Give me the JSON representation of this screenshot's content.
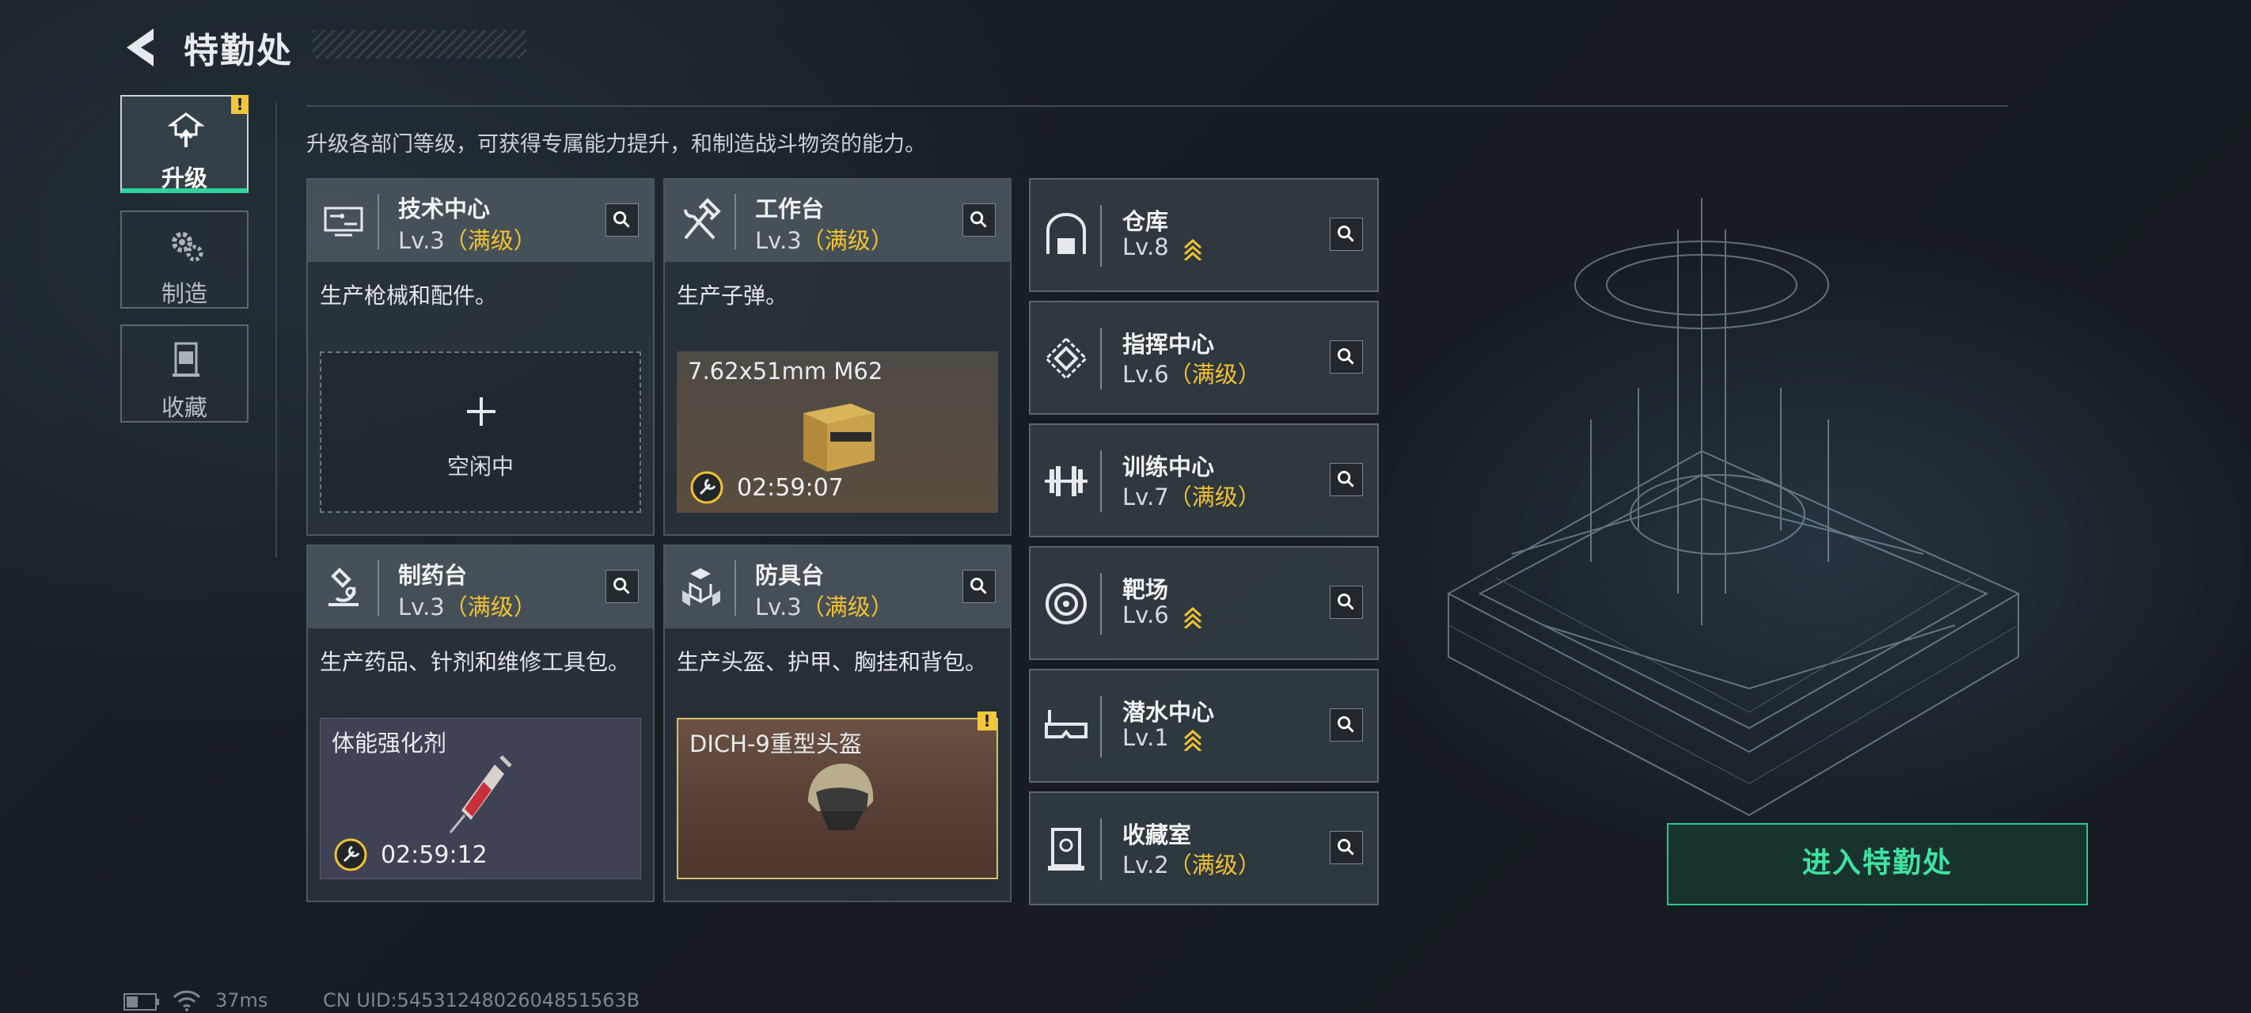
{
  "header": {
    "title": "特勤处",
    "back_icon": "back-arrow-icon"
  },
  "tabs": [
    {
      "label": "升级",
      "icon": "upgrade-icon",
      "active": true,
      "alert": "!"
    },
    {
      "label": "制造",
      "icon": "gear-icon",
      "active": false
    },
    {
      "label": "收藏",
      "icon": "trophy-icon",
      "active": false
    }
  ],
  "description": "升级各部门等级，可获得专属能力提升，和制造战斗物资的能力。",
  "facilities": [
    {
      "name": "技术中心",
      "level": "Lv.3",
      "max": "（满级）",
      "desc": "生产枪械和配件。",
      "icon": "tech-center-icon",
      "slot": {
        "state": "idle",
        "label": "空闲中"
      }
    },
    {
      "name": "工作台",
      "level": "Lv.3",
      "max": "（满级）",
      "desc": "生产子弹。",
      "icon": "hammer-wrench-icon",
      "slot": {
        "state": "producing",
        "item": "7.62x51mm M62",
        "time": "02:59:07",
        "item_icon": "ammo-box-icon"
      }
    },
    {
      "name": "制药台",
      "level": "Lv.3",
      "max": "（满级）",
      "desc": "生产药品、针剂和维修工具包。",
      "icon": "microscope-icon",
      "slot": {
        "state": "producing",
        "item": "体能强化剂",
        "time": "02:59:12",
        "item_icon": "syringe-icon"
      }
    },
    {
      "name": "防具台",
      "level": "Lv.3",
      "max": "（满级）",
      "desc": "生产头盔、护甲、胸挂和背包。",
      "icon": "armor-blocks-icon",
      "slot": {
        "state": "complete",
        "item": "DICH-9重型头盔",
        "alert": "!",
        "item_icon": "helmet-icon"
      }
    }
  ],
  "rooms": [
    {
      "name": "仓库",
      "level": "Lv.8",
      "max": "",
      "upgradable": true,
      "icon": "warehouse-icon"
    },
    {
      "name": "指挥中心",
      "level": "Lv.6",
      "max": "（满级）",
      "upgradable": false,
      "icon": "command-center-icon"
    },
    {
      "name": "训练中心",
      "level": "Lv.7",
      "max": "（满级）",
      "upgradable": false,
      "icon": "dumbbell-icon"
    },
    {
      "name": "靶场",
      "level": "Lv.6",
      "max": "",
      "upgradable": true,
      "icon": "target-icon"
    },
    {
      "name": "潜水中心",
      "level": "Lv.1",
      "max": "",
      "upgradable": true,
      "icon": "diving-mask-icon"
    },
    {
      "name": "收藏室",
      "level": "Lv.2",
      "max": "（满级）",
      "upgradable": false,
      "icon": "collection-room-icon"
    }
  ],
  "enter_button": "进入特勤处",
  "footer": {
    "ping": "37ms",
    "uid": "CN UID:5453124802604851563B"
  },
  "colors": {
    "accent_green": "#2fd49a",
    "max_gold": "#f2c230",
    "alert_yellow": "#f2c83a"
  }
}
